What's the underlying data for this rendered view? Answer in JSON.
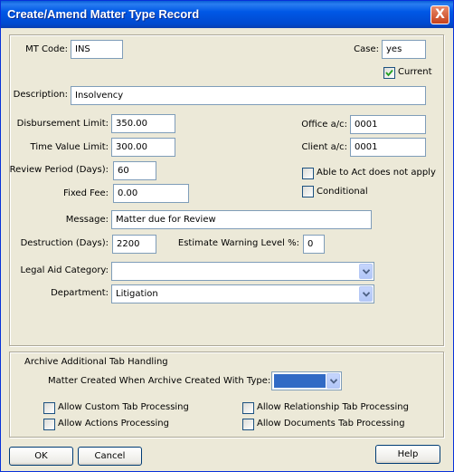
{
  "window": {
    "title": "Create/Amend Matter Type Record",
    "close_glyph": "X"
  },
  "form": {
    "mt_code": {
      "label": "MT Code:",
      "value": "INS"
    },
    "case": {
      "label": "Case:",
      "value": "yes"
    },
    "current": {
      "label": "Current",
      "checked": true
    },
    "description": {
      "label": "Description:",
      "value": "Insolvency"
    },
    "disbursement_limit": {
      "label": "Disbursement Limit:",
      "value": "350.00"
    },
    "office_ac": {
      "label": "Office a/c:",
      "value": "0001"
    },
    "time_value_limit": {
      "label": "Time Value Limit:",
      "value": "300.00"
    },
    "client_ac": {
      "label": "Client a/c:",
      "value": "0001"
    },
    "review_period": {
      "label": "Review Period (Days):",
      "value": "60"
    },
    "able_to_act": {
      "label": "Able to Act does not apply",
      "checked": false
    },
    "fixed_fee": {
      "label": "Fixed Fee:",
      "value": "0.00"
    },
    "conditional": {
      "label": "Conditional",
      "checked": false
    },
    "message": {
      "label": "Message:",
      "value": "Matter due for Review"
    },
    "destruction": {
      "label": "Destruction (Days):",
      "value": "2200"
    },
    "estimate_warning": {
      "label": "Estimate Warning Level %:",
      "value": "0"
    },
    "legal_aid_category": {
      "label": "Legal Aid Category:",
      "value": ""
    },
    "department": {
      "label": "Department:",
      "value": "Litigation"
    }
  },
  "archive": {
    "heading": "Archive Additional Tab Handling",
    "type_label": "Matter Created When Archive Created With Type:",
    "type_value": "",
    "selection_color": "#316ac5",
    "allow_custom": {
      "label": "Allow Custom Tab Processing",
      "checked": false
    },
    "allow_relationship": {
      "label": "Allow Relationship Tab Processing",
      "checked": false
    },
    "allow_actions": {
      "label": "Allow Actions Processing",
      "checked": false
    },
    "allow_documents": {
      "label": "Allow Documents Tab Processing",
      "checked": false
    }
  },
  "buttons": {
    "ok": "OK",
    "cancel": "Cancel",
    "help": "Help"
  }
}
